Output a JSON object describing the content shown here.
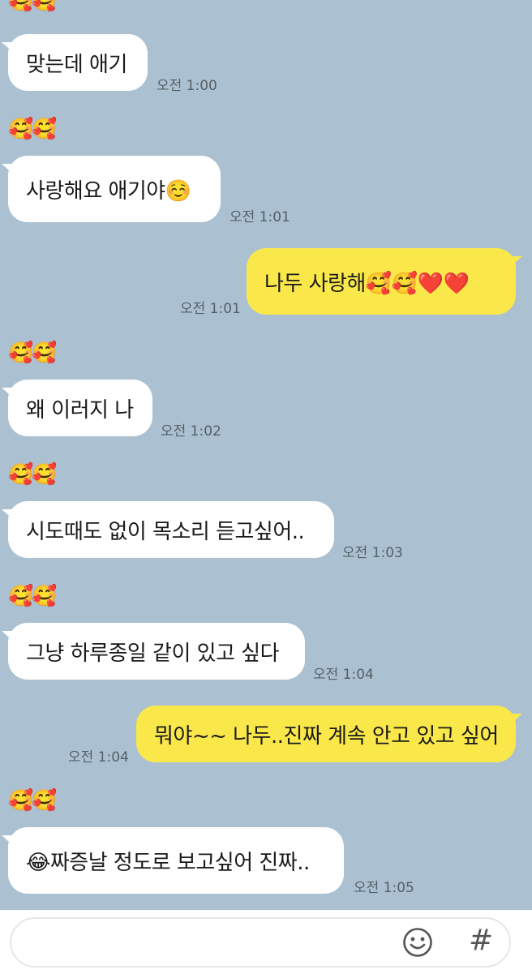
{
  "sender_avatar_emoji": "🥰🥰",
  "messages": [
    {
      "text": "맞는데 애기",
      "time": "오전 1:00"
    },
    {
      "text": "사랑해요 애기야☺️",
      "time": "오전 1:01"
    },
    {
      "text": "나두 사랑해🥰🥰❤️❤️",
      "time": "오전 1:01"
    },
    {
      "text": "왜 이러지 나",
      "time": "오전 1:02"
    },
    {
      "text": "시도때도 없이 목소리 듣고싶어..",
      "time": "오전 1:03"
    },
    {
      "text": "그냥 하루종일 같이 있고 싶다",
      "time": "오전 1:04"
    },
    {
      "text": "뭐야~~ 나두..진짜 계속 안고 있고 싶어",
      "time": "오전 1:04"
    },
    {
      "text": "😂짜증날 정도로 보고싶어 진짜..",
      "time": "오전 1:05"
    }
  ],
  "input": {
    "value": "",
    "placeholder": "",
    "emoji_icon": "smiley-face-icon",
    "hash_symbol": "#"
  },
  "colors": {
    "background": "#abc1d1",
    "incoming_bubble": "#ffffff",
    "outgoing_bubble": "#fae84b"
  }
}
